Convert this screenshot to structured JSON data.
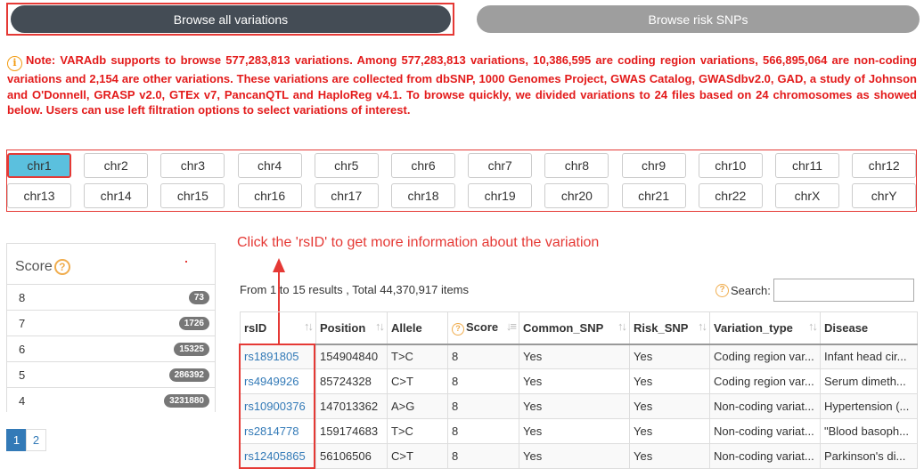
{
  "tabs": {
    "browse_all": "Browse all variations",
    "browse_risk": "Browse risk SNPs"
  },
  "note": {
    "icon": "info-icon",
    "text": "Note: VARAdb supports to browse 577,283,813 variations. Among 577,283,813 variations, 10,386,595 are coding region variations, 566,895,064 are non-coding variations and 2,154 are other variations. These variations are collected from dbSNP, 1000 Genomes Project, GWAS Catalog, GWASdbv2.0, GAD, a study of Johnson and O'Donnell, GRASP v2.0, GTEx v7, PancanQTL and HaploReg v4.1. To browse quickly, we divided variations to 24 files based on 24 chromosomes as showed below. Users can use left filtration options to select variations of interest."
  },
  "chromosomes": {
    "active": "chr1",
    "row1": [
      "chr1",
      "chr2",
      "chr3",
      "chr4",
      "chr5",
      "chr6",
      "chr7",
      "chr8",
      "chr9",
      "chr10",
      "chr11",
      "chr12"
    ],
    "row2": [
      "chr13",
      "chr14",
      "chr15",
      "chr16",
      "chr17",
      "chr18",
      "chr19",
      "chr20",
      "chr21",
      "chr22",
      "chrX",
      "chrY"
    ]
  },
  "score_filter": {
    "title": "Score",
    "items": [
      {
        "label": "8",
        "count": "73"
      },
      {
        "label": "7",
        "count": "1726"
      },
      {
        "label": "6",
        "count": "15325"
      },
      {
        "label": "5",
        "count": "286392"
      },
      {
        "label": "4",
        "count": "3231880"
      }
    ]
  },
  "pagination": {
    "pages": [
      "1",
      "2"
    ],
    "active": "1"
  },
  "hint": "Click the 'rsID' to get more information about the variation",
  "results": {
    "info": "From 1 to 15 results , Total 44,370,917 items",
    "search_label": "Search:",
    "search_value": ""
  },
  "table": {
    "headers": [
      "rsID",
      "Position",
      "Allele",
      "Score",
      "Common_SNP",
      "Risk_SNP",
      "Variation_type",
      "Disease"
    ],
    "rows": [
      [
        "rs1891805",
        "154904840",
        "T>C",
        "8",
        "Yes",
        "Yes",
        "Coding region var...",
        "Infant head cir..."
      ],
      [
        "rs4949926",
        "85724328",
        "C>T",
        "8",
        "Yes",
        "Yes",
        "Coding region var...",
        "Serum dimeth..."
      ],
      [
        "rs10900376",
        "147013362",
        "A>G",
        "8",
        "Yes",
        "Yes",
        "Non-coding variat...",
        "Hypertension (..."
      ],
      [
        "rs2814778",
        "159174683",
        "T>C",
        "8",
        "Yes",
        "Yes",
        "Non-coding variat...",
        "\"Blood basoph..."
      ],
      [
        "rs12405865",
        "56106506",
        "C>T",
        "8",
        "Yes",
        "Yes",
        "Non-coding variat...",
        "Parkinson's di..."
      ]
    ]
  },
  "colors": {
    "accent_red": "#e53935",
    "active_chr": "#5bc0de",
    "link": "#337ab7",
    "dark_tab": "#444c55",
    "grey_tab": "#9e9e9e"
  }
}
